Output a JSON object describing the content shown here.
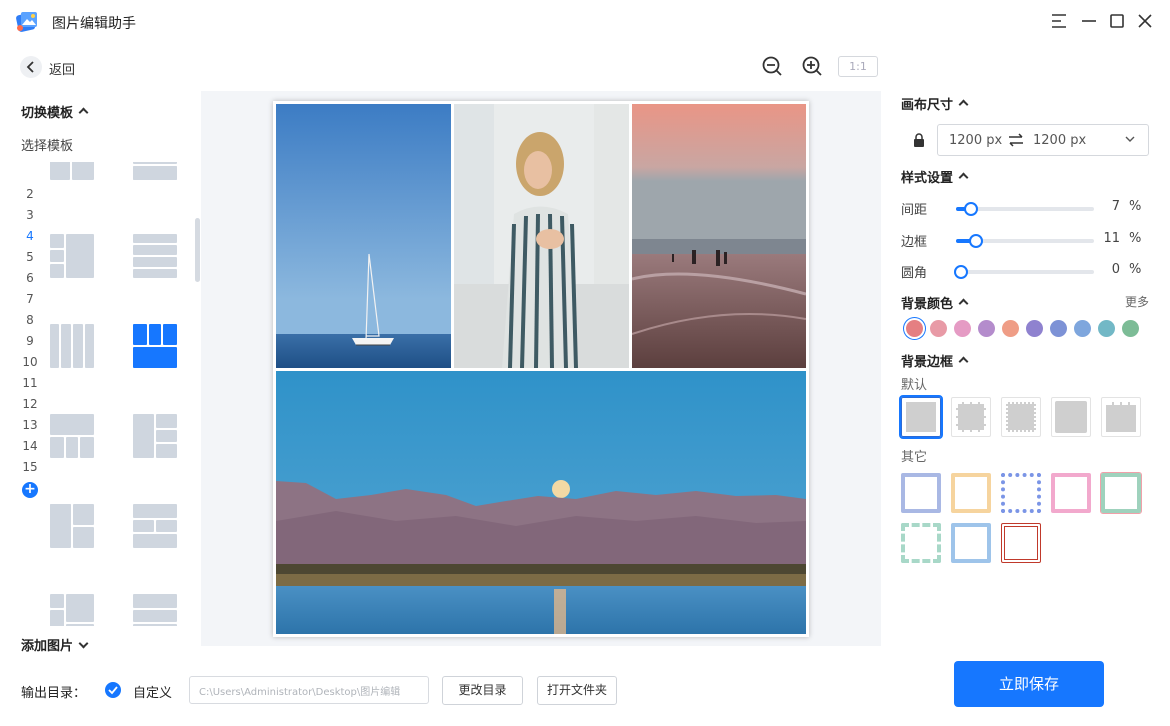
{
  "app": {
    "title": "图片编辑助手"
  },
  "nav": {
    "back_label": "返回"
  },
  "toolbar": {
    "ratio_label": "1:1"
  },
  "left": {
    "switch_template": "切换模板",
    "select_template": "选择模板",
    "counts": [
      "2",
      "3",
      "4",
      "5",
      "6",
      "7",
      "8",
      "9",
      "10",
      "11",
      "12",
      "13",
      "14",
      "15"
    ],
    "active_count": "4",
    "add_images": "添加图片"
  },
  "canvas_size": {
    "title": "画布尺寸",
    "width": "1200 px",
    "height": "1200 px"
  },
  "style": {
    "title": "样式设置",
    "sliders": [
      {
        "label": "间距",
        "value": "7",
        "unit": "%",
        "fraction": 0.07
      },
      {
        "label": "边框",
        "value": "11",
        "unit": "%",
        "fraction": 0.11
      },
      {
        "label": "圆角",
        "value": "0",
        "unit": "%",
        "fraction": 0.0
      }
    ]
  },
  "bg_color": {
    "title": "背景颜色",
    "more": "更多",
    "colors": [
      "#e57f82",
      "#e89aa6",
      "#e59bc4",
      "#b48ccc",
      "#ef9d86",
      "#8f82cf",
      "#7d92d6",
      "#7ea6dd",
      "#72b8c6",
      "#7cbc96"
    ],
    "selected": 0
  },
  "bg_frame": {
    "title": "背景边框",
    "default_label": "默认",
    "other_label": "其它"
  },
  "output": {
    "label": "输出目录：",
    "custom_label": "自定义",
    "path": "C:\\Users\\Administrator\\Desktop\\图片编辑",
    "change_dir": "更改目录",
    "open_folder": "打开文件夹",
    "save": "立即保存"
  }
}
